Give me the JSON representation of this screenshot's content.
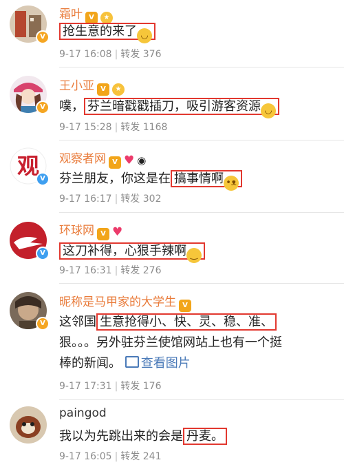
{
  "comments": [
    {
      "name": "霜叶",
      "verified": "V",
      "text_plain": "",
      "text_highlight": "抢生意的来了",
      "emoji": "cry-laugh-emoji",
      "time": "9-17 16:08",
      "repost_label": "转发",
      "repost_count": "376"
    },
    {
      "name": "王小亚",
      "verified": "V",
      "text_plain": "噗，",
      "text_highlight": "芬兰暗戳戳插刀，吸引游客资源",
      "emoji": "laugh-tears-emoji",
      "time": "9-17 15:28",
      "repost_label": "转发",
      "repost_count": "1168"
    },
    {
      "name": "观察者网",
      "verified": "V",
      "text_plain": "芬兰朋友，你这是在",
      "text_highlight": "搞事情啊",
      "emoji": "doge-emoji",
      "time": "9-17 16:17",
      "repost_label": "转发",
      "repost_count": "302"
    },
    {
      "name": "环球网",
      "verified": "V",
      "text_plain": "",
      "text_highlight": "这刀补得，心狠手辣啊",
      "emoji": "thinking-emoji",
      "time": "9-17 16:31",
      "repost_label": "转发",
      "repost_count": "276"
    },
    {
      "name": "昵称是马甲家的大学生",
      "verified": "V",
      "line1_plain": "这邻国",
      "line1_highlight": "生意抢得小、快、灵、稳、准、",
      "line2": "狠。。。另外驻芬兰使馆网站上也有一个挺",
      "line3": "棒的新闻。",
      "view_image": "查看图片",
      "time": "9-17 17:31",
      "repost_label": "转发",
      "repost_count": "176"
    },
    {
      "name": "paingod",
      "text_plain": "我以为先跳出来的会是",
      "text_highlight": "丹麦。",
      "time": "9-17 16:05",
      "repost_label": "转发",
      "repost_count": "241"
    }
  ],
  "colors": {
    "name": "#e97b3a",
    "highlight_border": "#e2382f",
    "meta": "#8c8c8c",
    "link": "#4a7ab8"
  }
}
